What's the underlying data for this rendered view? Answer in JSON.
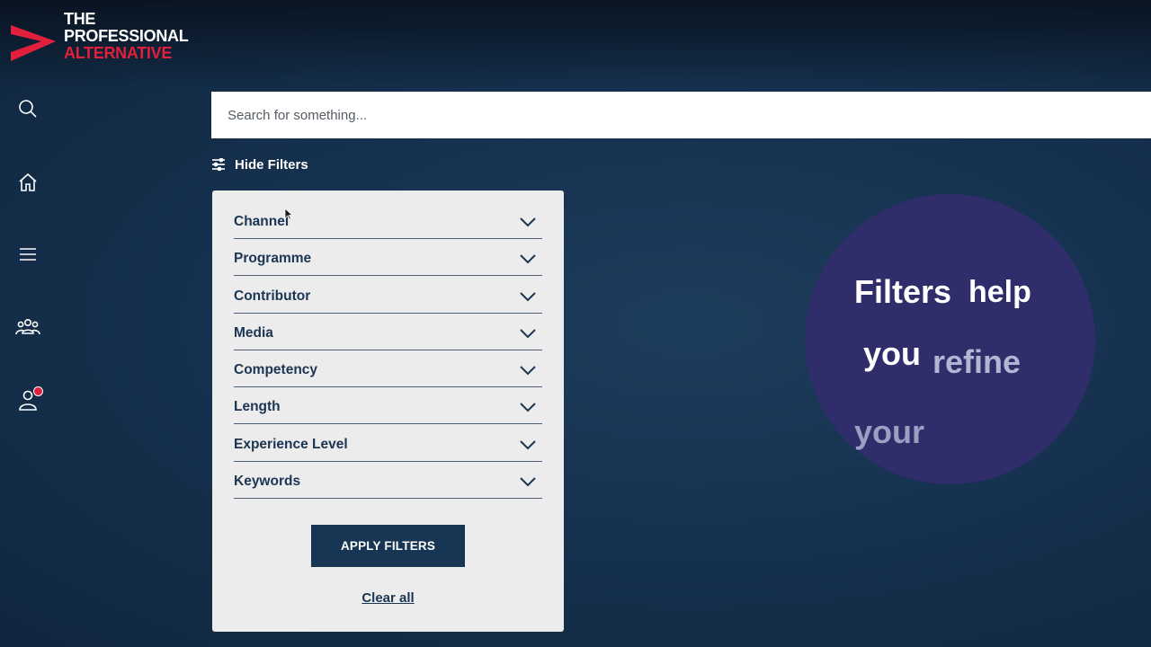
{
  "brand": {
    "line1": "THE",
    "line2": "PROFESSIONAL",
    "line3": "ALTERNATIVE",
    "accent_color": "#e0203c",
    "text_color": "#ffffff"
  },
  "nav": {
    "items": [
      {
        "icon": "search-icon"
      },
      {
        "icon": "home-icon"
      },
      {
        "icon": "menu-icon"
      },
      {
        "icon": "community-icon"
      },
      {
        "icon": "profile-icon",
        "has_notification": true
      }
    ]
  },
  "search": {
    "placeholder": "Search for something...",
    "value": ""
  },
  "filters_toggle": {
    "label": "Hide Filters",
    "icon": "filter-sliders-icon"
  },
  "filters": {
    "items": [
      {
        "label": "Channel"
      },
      {
        "label": "Programme"
      },
      {
        "label": "Contributor"
      },
      {
        "label": "Media"
      },
      {
        "label": "Competency"
      },
      {
        "label": "Length"
      },
      {
        "label": "Experience Level"
      },
      {
        "label": "Keywords"
      }
    ],
    "apply_label": "APPLY FILTERS",
    "clear_label": "Clear all"
  },
  "tip": {
    "w1": "Filters",
    "w2": "help",
    "w3": "you",
    "w4": "refine",
    "w5": "your",
    "bubble_color": "#2f2d6a"
  },
  "colors": {
    "background": "#163250",
    "panel": "#ececec",
    "primary_button": "#173654",
    "text_dark": "#1b3552"
  }
}
